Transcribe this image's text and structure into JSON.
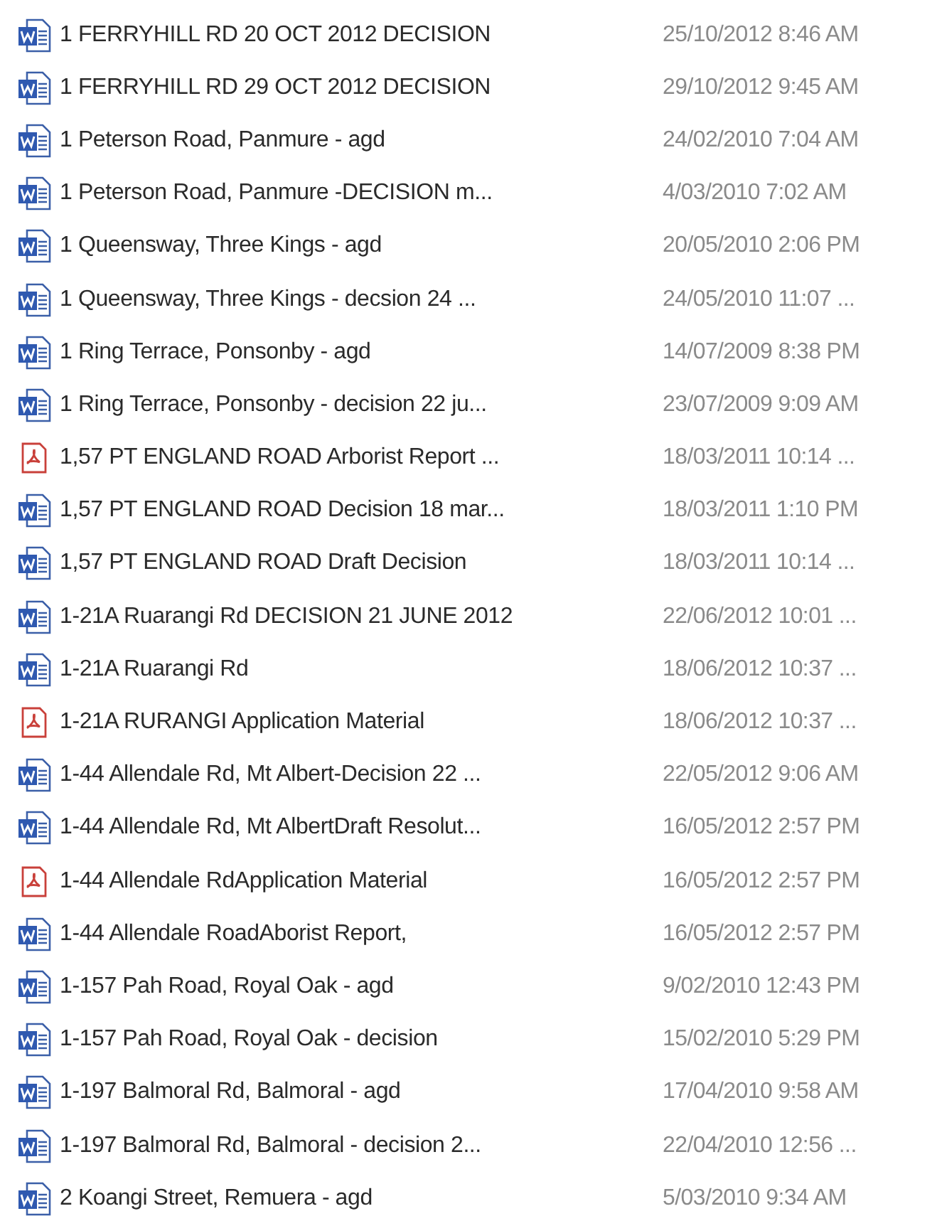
{
  "files": [
    {
      "kind": "word",
      "name": "1 FERRYHILL RD 20 OCT 2012 DECISION",
      "modified": "25/10/2012 8:46 AM"
    },
    {
      "kind": "word",
      "name": "1 FERRYHILL RD 29 OCT 2012 DECISION",
      "modified": "29/10/2012 9:45 AM"
    },
    {
      "kind": "word",
      "name": "1 Peterson Road, Panmure - agd",
      "modified": "24/02/2010 7:04 AM"
    },
    {
      "kind": "word",
      "name": "1 Peterson Road, Panmure -DECISION m...",
      "modified": "4/03/2010 7:02 AM"
    },
    {
      "kind": "word",
      "name": "1 Queensway, Three Kings - agd",
      "modified": "20/05/2010 2:06 PM"
    },
    {
      "kind": "word",
      "name": "1 Queensway, Three Kings - decsion 24 ...",
      "modified": "24/05/2010 11:07 ..."
    },
    {
      "kind": "word",
      "name": "1 Ring Terrace, Ponsonby - agd",
      "modified": "14/07/2009 8:38 PM"
    },
    {
      "kind": "word",
      "name": "1 Ring Terrace, Ponsonby - decision 22 ju...",
      "modified": "23/07/2009 9:09 AM"
    },
    {
      "kind": "pdf",
      "name": "1,57 PT ENGLAND ROAD Arborist Report ...",
      "modified": "18/03/2011 10:14 ..."
    },
    {
      "kind": "word",
      "name": "1,57 PT ENGLAND ROAD Decision 18 mar...",
      "modified": "18/03/2011 1:10 PM"
    },
    {
      "kind": "word",
      "name": "1,57 PT ENGLAND ROAD Draft Decision",
      "modified": "18/03/2011 10:14 ..."
    },
    {
      "kind": "word",
      "name": "1-21A Ruarangi Rd DECISION 21 JUNE 2012",
      "modified": "22/06/2012 10:01 ..."
    },
    {
      "kind": "word",
      "name": "1-21A Ruarangi Rd",
      "modified": "18/06/2012 10:37 ..."
    },
    {
      "kind": "pdf",
      "name": "1-21A RURANGI Application Material",
      "modified": "18/06/2012 10:37 ..."
    },
    {
      "kind": "word",
      "name": "1-44 Allendale Rd, Mt Albert-Decision 22 ...",
      "modified": "22/05/2012 9:06 AM"
    },
    {
      "kind": "word",
      "name": "1-44 Allendale Rd, Mt AlbertDraft Resolut...",
      "modified": "16/05/2012 2:57 PM"
    },
    {
      "kind": "pdf",
      "name": "1-44 Allendale RdApplication Material",
      "modified": "16/05/2012 2:57 PM"
    },
    {
      "kind": "word",
      "name": "1-44 Allendale RoadAborist Report,",
      "modified": "16/05/2012 2:57 PM"
    },
    {
      "kind": "word",
      "name": "1-157 Pah Road, Royal Oak - agd",
      "modified": "9/02/2010 12:43 PM"
    },
    {
      "kind": "word",
      "name": "1-157 Pah Road, Royal Oak - decision",
      "modified": "15/02/2010 5:29 PM"
    },
    {
      "kind": "word",
      "name": "1-197 Balmoral Rd, Balmoral - agd",
      "modified": "17/04/2010 9:58 AM"
    },
    {
      "kind": "word",
      "name": "1-197 Balmoral Rd, Balmoral - decision 2...",
      "modified": "22/04/2010 12:56 ..."
    },
    {
      "kind": "word",
      "name": "2 Koangi Street, Remuera - agd",
      "modified": "5/03/2010 9:34 AM"
    }
  ]
}
